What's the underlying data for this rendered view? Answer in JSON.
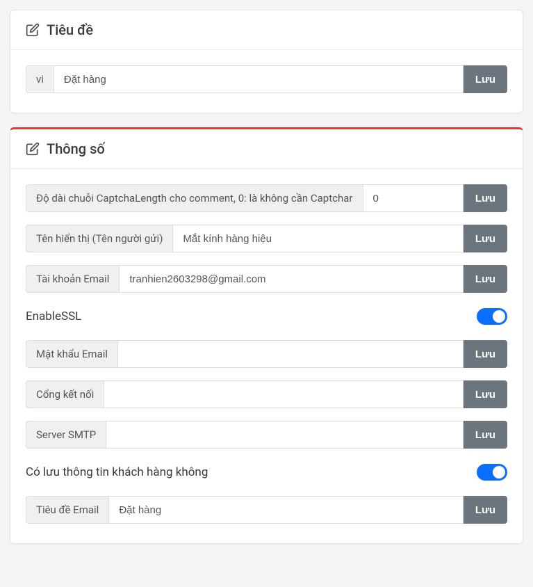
{
  "panels": {
    "title": {
      "heading": "Tiêu đề",
      "row": {
        "prefix": "vi",
        "value": "Đặt hàng",
        "save": "Lưu"
      }
    },
    "params": {
      "heading": "Thông số",
      "rows": {
        "captcha": {
          "label": "Độ dài chuỗi CaptchaLength cho comment, 0: là không cần Captchar",
          "value": "0",
          "save": "Lưu"
        },
        "display": {
          "label": "Tên hiển thị (Tên người gửi)",
          "value": "Mắt kính hàng hiệu",
          "save": "Lưu"
        },
        "email": {
          "label": "Tài khoản Email",
          "value": "tranhien2603298@gmail.com",
          "save": "Lưu"
        },
        "ssl": {
          "label": "EnableSSL"
        },
        "pass": {
          "label": "Mật khẩu Email",
          "value": "",
          "save": "Lưu"
        },
        "port": {
          "label": "Cổng kết nối",
          "value": "",
          "save": "Lưu"
        },
        "smtp": {
          "label": "Server SMTP",
          "value": "",
          "save": "Lưu"
        },
        "storecust": {
          "label": "Có lưu thông tin khách hàng không"
        },
        "subject": {
          "label": "Tiêu đề Email",
          "value": "Đặt hàng",
          "save": "Lưu"
        }
      }
    }
  }
}
